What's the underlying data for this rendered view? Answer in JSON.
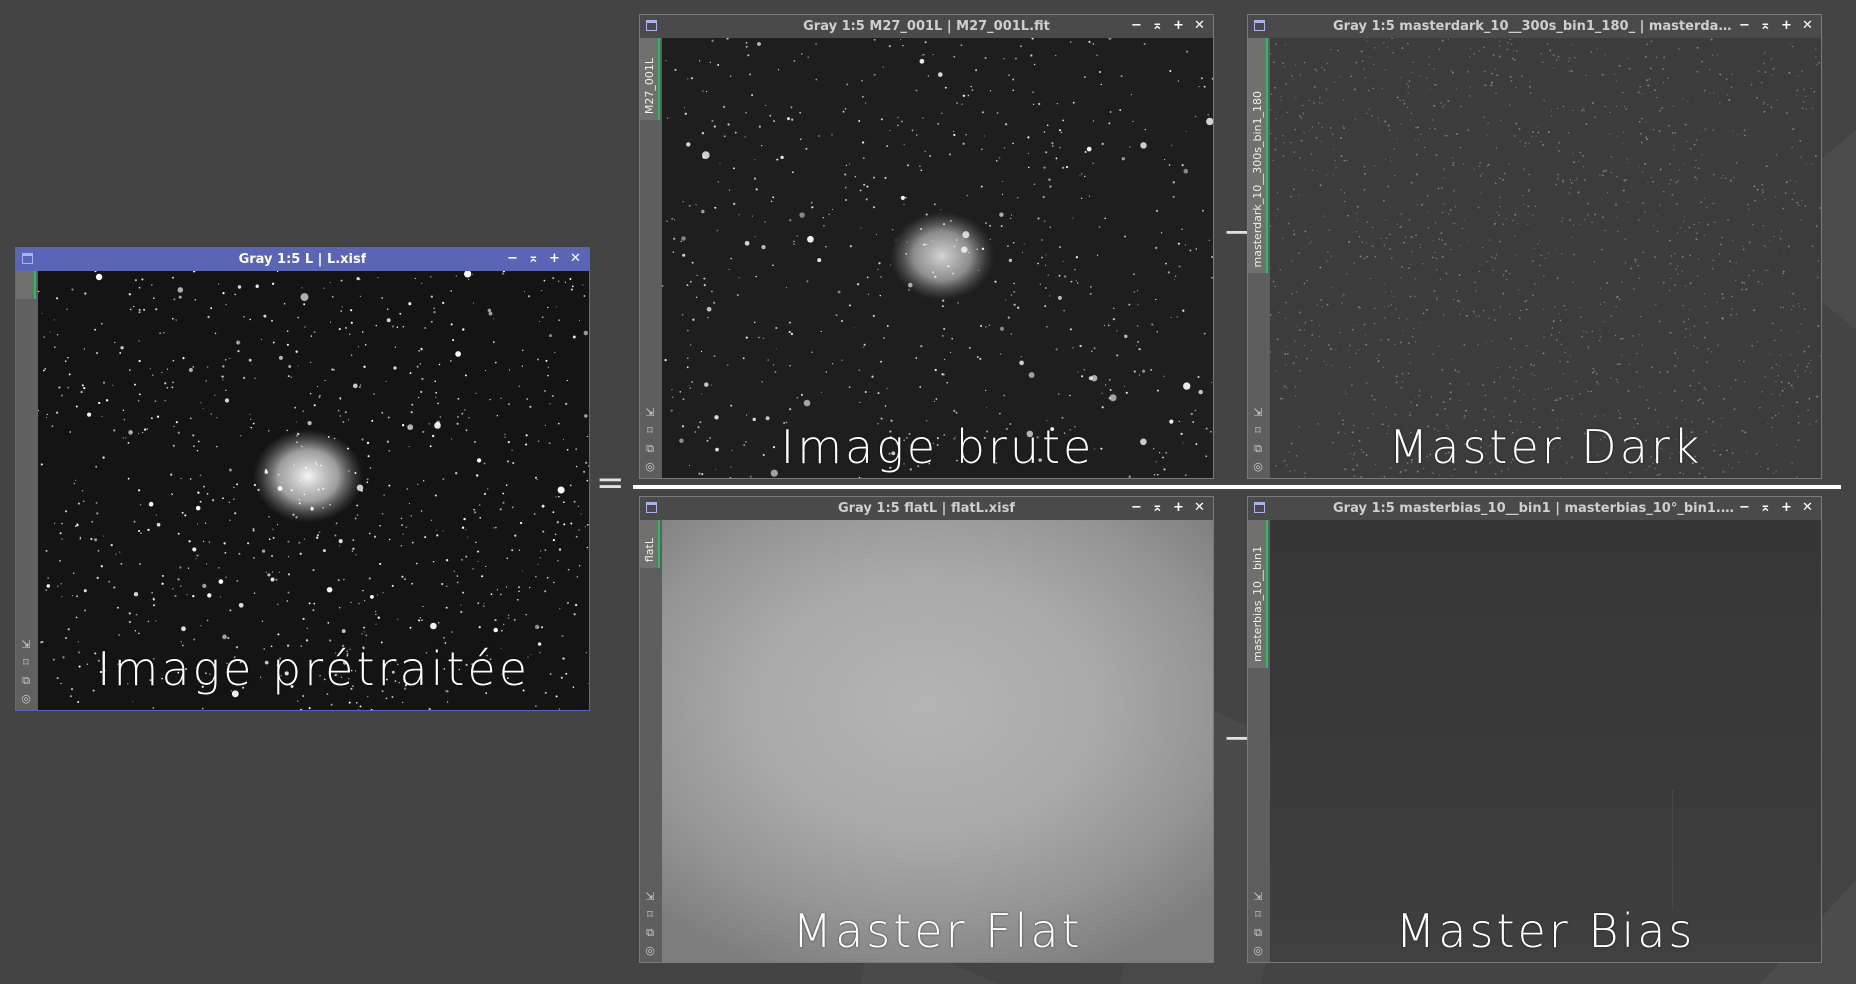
{
  "windows": {
    "preprocessed": {
      "title": "Gray 1:5 L | L.xisf",
      "tab": "",
      "label": "Image prétraitée"
    },
    "raw": {
      "title": "Gray 1:5 M27_001L | M27_001L.fit",
      "tab": "M27_001L",
      "label": "Image brute"
    },
    "dark": {
      "title": "Gray 1:5 masterdark_10__300s_bin1_180_ | masterdark_10°...",
      "tab": "masterdark_10__300s_bin1_180",
      "label": "Master Dark"
    },
    "flat": {
      "title": "Gray 1:5 flatL | flatL.xisf",
      "tab": "flatL",
      "label": "Master Flat"
    },
    "bias": {
      "title": "Gray 1:5 masterbias_10__bin1 | masterbias_10°_bin1.xisf",
      "tab": "masterbias_10__bin1",
      "label": "Master Bias"
    }
  },
  "controls": {
    "minimize": "−",
    "shade": "⌅",
    "maximize": "+",
    "close": "✕"
  },
  "operators": {
    "equals": "=",
    "minus_top": "−",
    "minus_bottom": "−"
  },
  "icons": [
    "window-icon",
    "zoom-fit-icon",
    "pan-icon",
    "clone-icon",
    "target-icon"
  ],
  "colors": {
    "desktop": "#444444",
    "active_titlebar": "#5b65b6",
    "inactive_titlebar": "#4a4a4a",
    "tab_marker": "#23c35a"
  }
}
